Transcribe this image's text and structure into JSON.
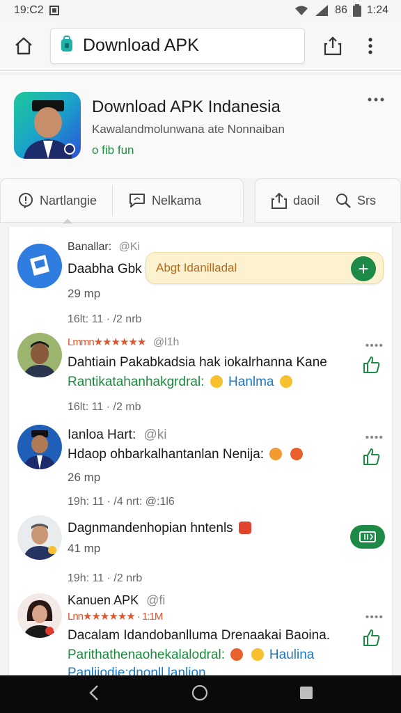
{
  "status_bar": {
    "left_text": "19:C2",
    "percent": "86",
    "time": "1:24"
  },
  "browser": {
    "url_title": "Download APK"
  },
  "app": {
    "title": "Download APK Indanesia",
    "subtitle": "Kawalandmolunwana ate Nonnaiban",
    "tag": "o fib fun"
  },
  "tabs": [
    {
      "label": "Nartlangie",
      "icon": "info-bubble-icon"
    },
    {
      "label": "Nelkama",
      "icon": "chat-bubble-icon"
    },
    {
      "label": "daoil",
      "icon": "share-icon"
    },
    {
      "label": "Srs",
      "icon": "search-icon"
    }
  ],
  "toast": {
    "label": "Abgt Idanilladal",
    "add_symbol": "+"
  },
  "feed": [
    {
      "meta_name": "Banallar:",
      "meta_extra": "@Ki",
      "title": "Daabha Gbk",
      "sub": "29 mp",
      "time": "16lt: 11 · /2 nrb"
    },
    {
      "meta_name": "Lmmn★★★★★★",
      "meta_extra": "@l1h",
      "text": "Dahtiain Pakabkadsia hak iokalrhanna Kane",
      "green": "Rantikatahanhakgrdral:",
      "blue": "Hanlma",
      "time": "16lt: 11 · /2 mb"
    },
    {
      "meta_name": "Ianloa Hart:",
      "meta_extra": "@ki",
      "text": "Hdaop ohbarkalhantanlan Nenija:",
      "sub": "26 mp",
      "time": "19h: 11 · /4 nrt: @:1l6"
    },
    {
      "text": "Dagnmandenhopian hntenls",
      "sub": "41 mp",
      "time": "19h: 11 · /2 nrb"
    },
    {
      "meta_name": "Kanuen APK",
      "meta_extra": "@fi",
      "rating": "Lnn★★★★★★ · 1:1M",
      "text": "Dacalam Idandobanlluma Drenaakai Baoina.",
      "green": "Parithathenaohekalalodral:",
      "blue": "Haulina",
      "overflow": "Panliiodie:dnonll lanlion"
    }
  ],
  "colors": {
    "accent_green": "#1e8a47",
    "toast_bg": "#fdf2cf",
    "star_orange": "#e0542b",
    "link_blue": "#1d76c2"
  }
}
